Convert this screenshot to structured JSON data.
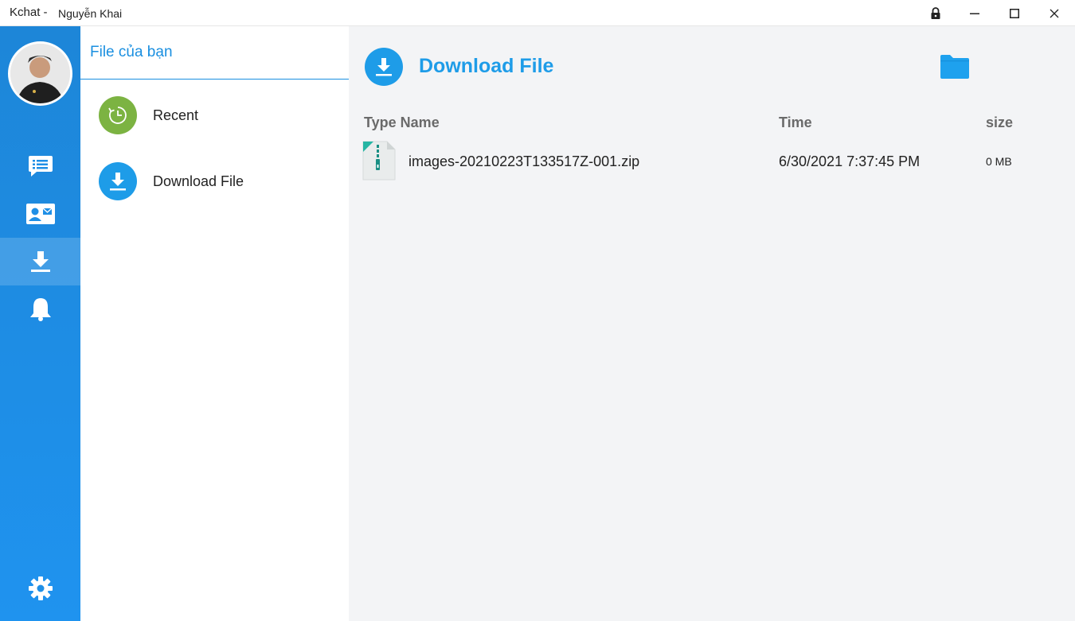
{
  "window": {
    "app_title": "Kchat -",
    "user_name": "Nguyễn Khai"
  },
  "rail": {
    "items": [
      {
        "icon": "chat-list-icon"
      },
      {
        "icon": "contact-card-icon"
      },
      {
        "icon": "download-icon",
        "active": true
      },
      {
        "icon": "bell-icon"
      },
      {
        "icon": "gear-icon"
      }
    ]
  },
  "middle": {
    "title": "File của bạn",
    "items": [
      {
        "label": "Recent",
        "icon": "clock-icon",
        "color": "#7cb342"
      },
      {
        "label": "Download File",
        "icon": "download-icon",
        "color": "#1e9ce8"
      }
    ]
  },
  "content": {
    "heading": "Download File",
    "columns": {
      "type_name": "Type Name",
      "time": "Time",
      "size": "size"
    },
    "files": [
      {
        "name": "images-20210223T133517Z-001.zip",
        "time": "6/30/2021 7:37:45 PM",
        "size": "0 MB",
        "icon": "zip-file-icon"
      }
    ]
  },
  "colors": {
    "accent": "#1e9ce8",
    "rail": "#1f8fe6",
    "recent": "#7cb342"
  }
}
